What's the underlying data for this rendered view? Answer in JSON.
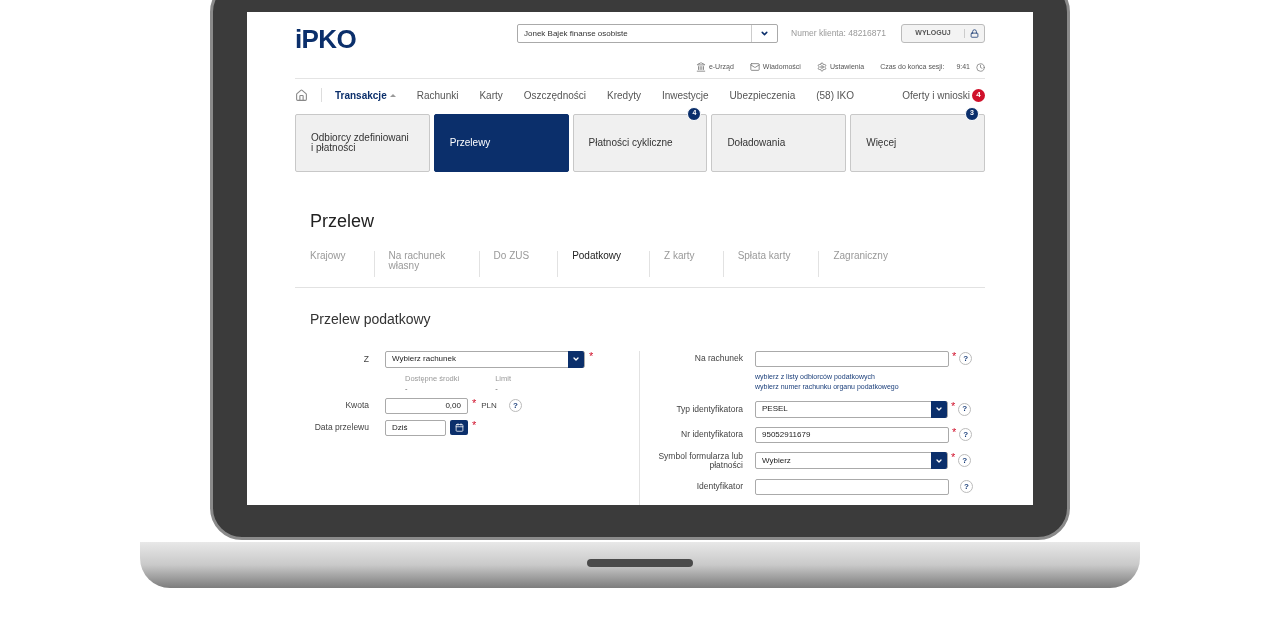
{
  "header": {
    "logo": "iPKO",
    "account_select": {
      "value": "Jonek Bajek finanse osobiste"
    },
    "client_number": "Numer klienta: 48216871",
    "logout": "WYLOGUJ"
  },
  "utility_links": [
    {
      "label": "e-Urząd"
    },
    {
      "label": "Wiadomości"
    },
    {
      "label": "Ustawienia"
    }
  ],
  "session": {
    "label": "Czas do końca sesji:",
    "time": "9:41"
  },
  "nav": [
    {
      "label": "Transakcje",
      "selected": true
    },
    {
      "label": "Rachunki",
      "selected": false
    },
    {
      "label": "Karty",
      "selected": false
    },
    {
      "label": "Oszczędności",
      "selected": false
    },
    {
      "label": "Kredyty",
      "selected": false
    },
    {
      "label": "Inwestycje",
      "selected": false
    },
    {
      "label": "Ubezpieczenia",
      "selected": false
    },
    {
      "label": "(58) IKO",
      "selected": false
    }
  ],
  "offers": {
    "label": "Oferty i wnioski",
    "badge": "4"
  },
  "tiles": [
    {
      "label": "Odbiorcy zdefiniowani i płatności",
      "selected": false
    },
    {
      "label": "Przelewy",
      "selected": true
    },
    {
      "label": "Płatności cykliczne",
      "selected": false,
      "badge": "4"
    },
    {
      "label": "Doładowania",
      "selected": false
    },
    {
      "label": "Więcej",
      "selected": false,
      "badge": "3"
    }
  ],
  "page_title": "Przelew",
  "subtabs": [
    {
      "label": "Krajowy",
      "selected": false
    },
    {
      "label": "Na rachunek własny",
      "selected": false
    },
    {
      "label": "Do ZUS",
      "selected": false
    },
    {
      "label": "Podatkowy",
      "selected": true
    },
    {
      "label": "Z karty",
      "selected": false
    },
    {
      "label": "Spłata karty",
      "selected": false
    },
    {
      "label": "Zagraniczny",
      "selected": false
    }
  ],
  "section_title": "Przelew podatkowy",
  "left_fields": [
    {
      "kind": "select",
      "label": "Z",
      "value": "Wybierz rachunek",
      "required": "*",
      "info": [
        {
          "label": "Dostępne środki",
          "value": "-"
        },
        {
          "label": "Limit",
          "value": "-"
        }
      ]
    },
    {
      "kind": "amount",
      "label": "Kwota",
      "value": "0,00",
      "required": "*",
      "unit": "PLN",
      "help": "?"
    },
    {
      "kind": "date",
      "label": "Data przelewu",
      "value": "Dziś",
      "required": "*"
    }
  ],
  "right_fields": [
    {
      "kind": "text",
      "label": "Na rachunek",
      "required": "*",
      "help": "?",
      "links": [
        "wybierz z listy odbiorców podatkowych",
        "wybierz numer rachunku organu podatkowego"
      ]
    },
    {
      "kind": "select",
      "label": "Typ identyfikatora",
      "value": "PESEL",
      "required": "*",
      "help": "?"
    },
    {
      "kind": "text",
      "label": "Nr identyfikatora",
      "value": "95052911679",
      "required": "*",
      "help": "?"
    },
    {
      "kind": "select",
      "label": "Symbol formularza lub płatności",
      "value": "Wybierz",
      "required": "*",
      "help": "?"
    },
    {
      "kind": "text",
      "label": "Identyfikator",
      "help": "?"
    }
  ]
}
